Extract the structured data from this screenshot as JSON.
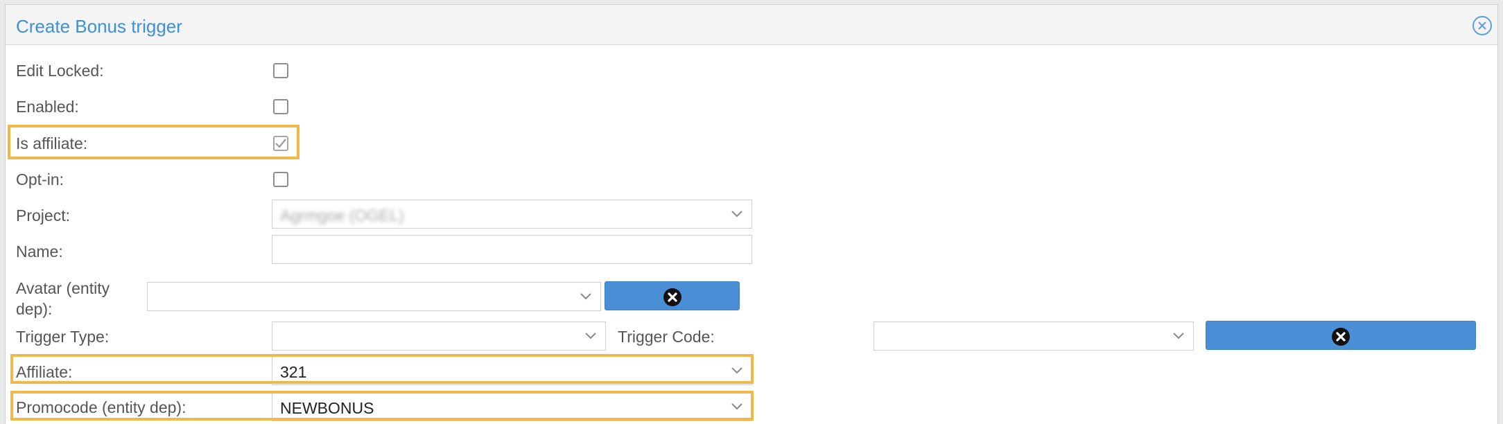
{
  "dialog": {
    "title": "Create Bonus trigger"
  },
  "fields": {
    "edit_locked": {
      "label": "Edit Locked:",
      "checked": false
    },
    "enabled": {
      "label": "Enabled:",
      "checked": false
    },
    "is_affiliate": {
      "label": "Is affiliate:",
      "checked": true
    },
    "opt_in": {
      "label": "Opt-in:",
      "checked": false
    },
    "project": {
      "label": "Project:",
      "value": "Agrmgoe (OGEL)"
    },
    "name": {
      "label": "Name:",
      "value": ""
    },
    "avatar": {
      "label": "Avatar (entity dep):",
      "value": ""
    },
    "trigger_type": {
      "label": "Trigger Type:",
      "value": ""
    },
    "trigger_code": {
      "label": "Trigger Code:",
      "value": ""
    },
    "affiliate": {
      "label": "Affiliate:",
      "value": "321"
    },
    "promocode": {
      "label": "Promocode (entity dep):",
      "value": "NEWBONUS"
    }
  },
  "icons": {
    "close": "close-circle-icon",
    "clear": "clear-circle-icon",
    "chevron": "chevron-down-icon"
  },
  "colors": {
    "accent": "#3f8fd6",
    "button": "#4a8fd6",
    "highlight": "#f0b84a"
  }
}
